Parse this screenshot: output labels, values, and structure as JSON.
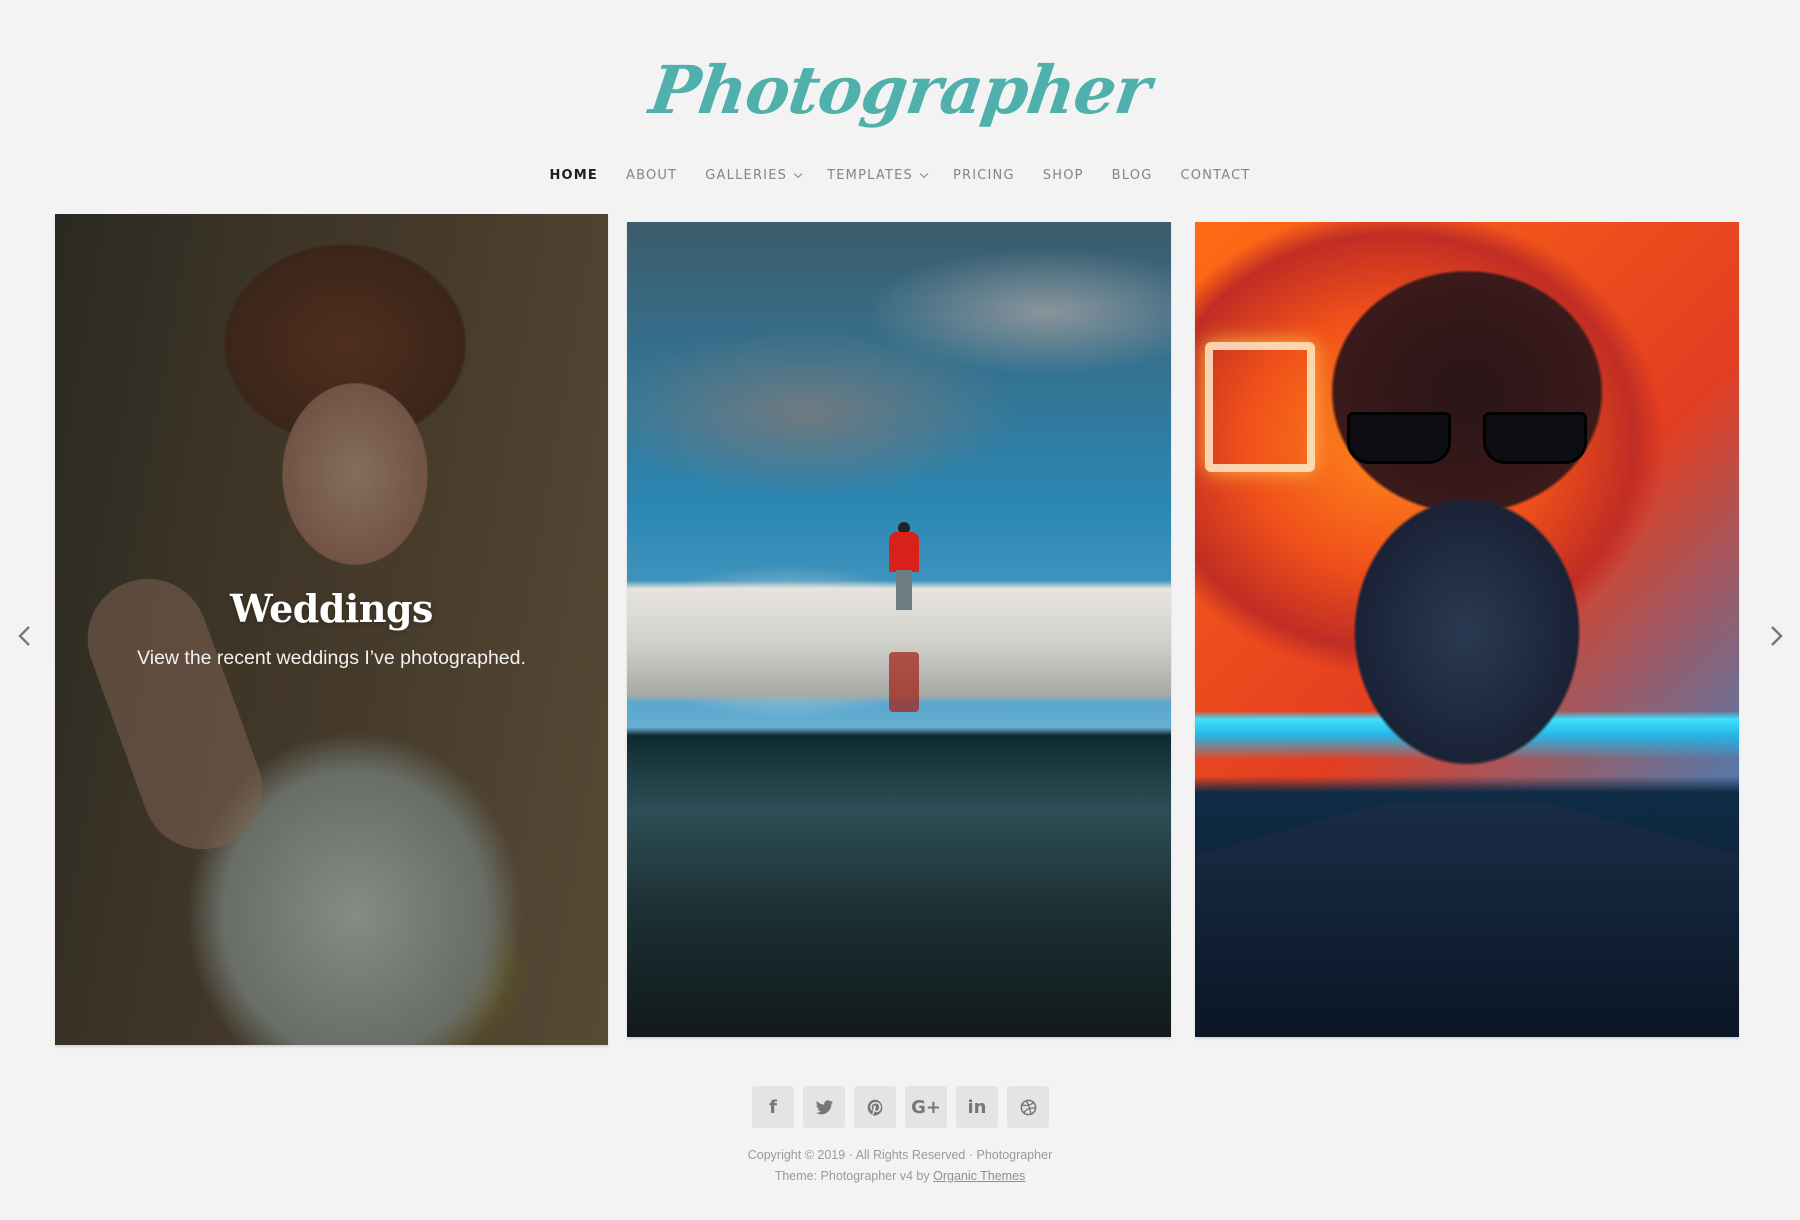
{
  "site": {
    "logo_text": "Photographer",
    "brand_color": "#4fb0ac",
    "background_color": "#f3f3f3"
  },
  "nav": {
    "items": [
      {
        "label": "HOME",
        "active": true,
        "has_dropdown": false
      },
      {
        "label": "ABOUT",
        "active": false,
        "has_dropdown": false
      },
      {
        "label": "GALLERIES",
        "active": false,
        "has_dropdown": true
      },
      {
        "label": "TEMPLATES",
        "active": false,
        "has_dropdown": true
      },
      {
        "label": "PRICING",
        "active": false,
        "has_dropdown": false
      },
      {
        "label": "SHOP",
        "active": false,
        "has_dropdown": false
      },
      {
        "label": "BLOG",
        "active": false,
        "has_dropdown": false
      },
      {
        "label": "CONTACT",
        "active": false,
        "has_dropdown": false
      }
    ]
  },
  "slider": {
    "prev_icon": "chevron-left-icon",
    "next_icon": "chevron-right-icon",
    "slides": [
      {
        "subject": "bride with bouquet",
        "title": "Weddings",
        "subtitle": "View the recent weddings I’ve photographed.",
        "active": true
      },
      {
        "subject": "hiker in red jacket on glacier with reflection",
        "title": "",
        "subtitle": "",
        "active": false
      },
      {
        "subject": "man in sunglasses in front of neon signs",
        "title": "",
        "subtitle": "",
        "active": false
      }
    ]
  },
  "social": {
    "icons": [
      {
        "name": "facebook-icon",
        "glyph": "f"
      },
      {
        "name": "twitter-icon",
        "glyph": ""
      },
      {
        "name": "pinterest-icon",
        "glyph": ""
      },
      {
        "name": "google-plus-icon",
        "glyph": "G+"
      },
      {
        "name": "linkedin-icon",
        "glyph": "in"
      },
      {
        "name": "dribbble-icon",
        "glyph": ""
      }
    ]
  },
  "footer": {
    "copyright": "Copyright © 2019 · All Rights Reserved · Photographer",
    "theme_prefix": "Theme: Photographer v4 by ",
    "theme_link": "Organic Themes"
  }
}
